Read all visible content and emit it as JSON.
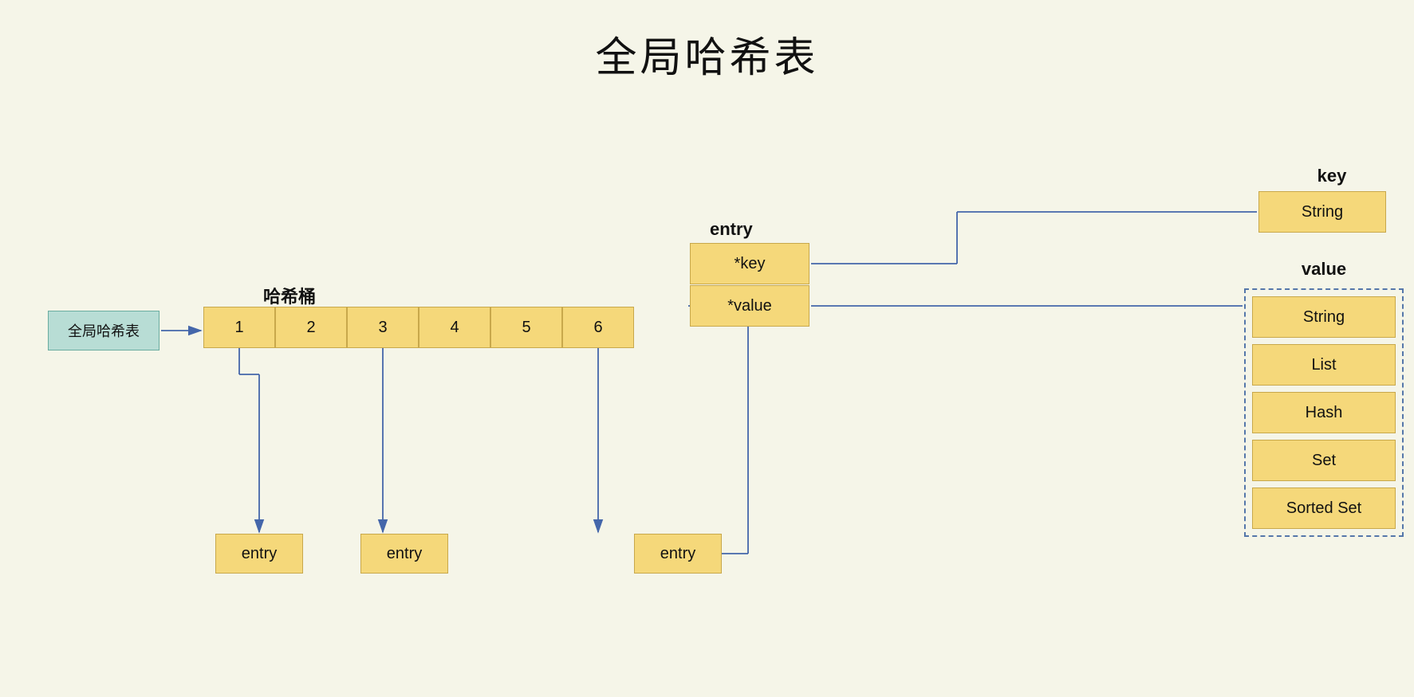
{
  "title": "全局哈希表",
  "global_hashtable_label": "全局哈希表",
  "bucket_label": "哈希桶",
  "buckets": [
    "1",
    "2",
    "3",
    "4",
    "5",
    "6"
  ],
  "entry_label": "entry",
  "entry_fields": [
    "*key",
    "*value"
  ],
  "entry_bucket_labels": [
    "entry",
    "entry",
    "entry"
  ],
  "key_section": {
    "label": "key",
    "types": [
      "String"
    ]
  },
  "value_section": {
    "label": "value",
    "types": [
      "String",
      "List",
      "Hash",
      "Set",
      "Sorted Set"
    ]
  }
}
